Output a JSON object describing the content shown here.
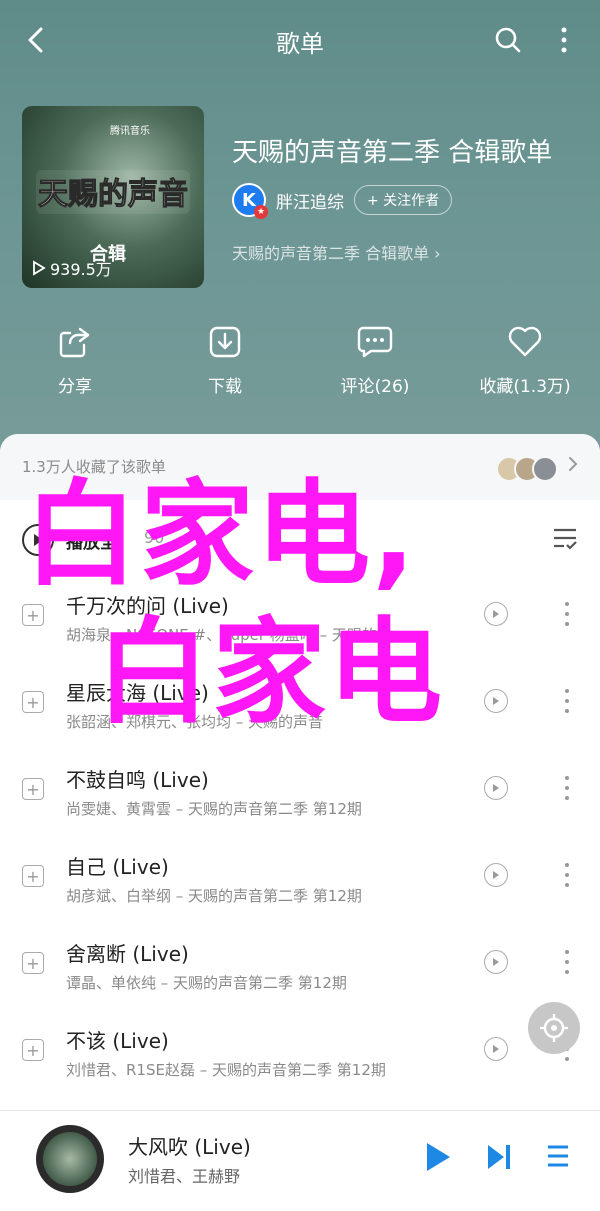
{
  "header": {
    "title": "歌单"
  },
  "playlist": {
    "cover_logo_text": "腾讯音乐",
    "cover_art_text": "天赐的声音",
    "cover_subtitle": "合辑",
    "play_count": "939.5万",
    "title": "天赐的声音第二季 合辑歌单",
    "creator_name": "胖汪追综",
    "follow_label": "+ 关注作者",
    "description": "天赐的声音第二季 合辑歌单 ›"
  },
  "actions": [
    {
      "label": "分享",
      "icon": "share-icon"
    },
    {
      "label": "下载",
      "icon": "download-icon"
    },
    {
      "label": "评论(26)",
      "icon": "comment-icon"
    },
    {
      "label": "收藏(1.3万)",
      "icon": "heart-icon"
    }
  ],
  "collect": {
    "text": "1.3万人收藏了该歌单"
  },
  "play_all": {
    "label": "播放全",
    "count": "90"
  },
  "tracks": [
    {
      "name": "千万次的问 (Live)",
      "artists": "胡海泉、N9EONE #、Super 杨蓝晴 – 天赐的"
    },
    {
      "name": "星辰大海 (Live)",
      "artists": "张韶涵、郑棋元、张均均 – 天赐的声音"
    },
    {
      "name": "不鼓自鸣 (Live)",
      "artists": "尚雯婕、黄霄雲 – 天赐的声音第二季 第12期"
    },
    {
      "name": "自己 (Live)",
      "artists": "胡彦斌、白举纲 – 天赐的声音第二季 第12期"
    },
    {
      "name": "舍离断 (Live)",
      "artists": "谭晶、单依纯 – 天赐的声音第二季 第12期"
    },
    {
      "name": "不该 (Live)",
      "artists": "刘惜君、R1SE赵磊 – 天赐的声音第二季 第12期"
    }
  ],
  "watermark": {
    "line1": "白家电,",
    "line2": "白家电"
  },
  "now_playing": {
    "title": "大风吹 (Live)",
    "artists": "刘惜君、王赫野"
  },
  "colors": {
    "accent": "#1e88e5",
    "watermark": "#ff18f5",
    "hero": "#6b9593"
  }
}
